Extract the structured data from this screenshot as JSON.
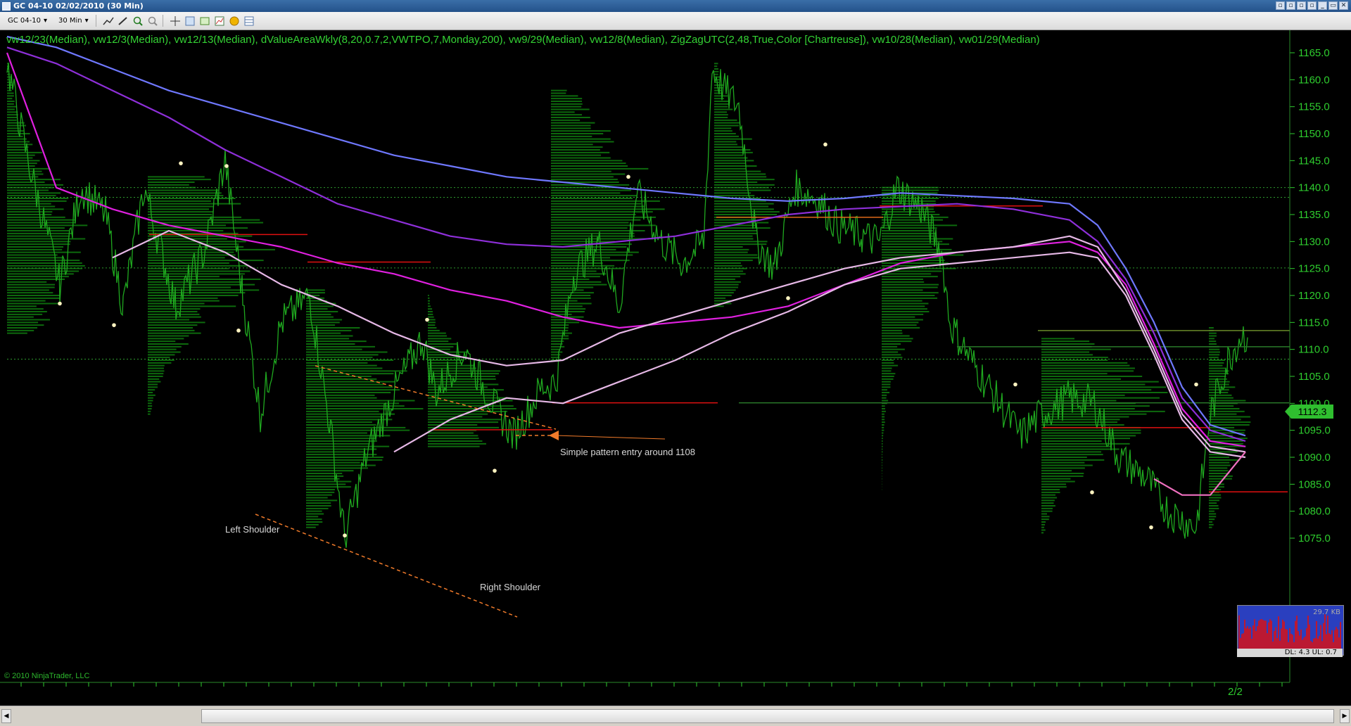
{
  "window": {
    "title": "GC 04-10  02/02/2010 (30 Min)",
    "buttons": [
      "▫",
      "▫",
      "▫",
      "▫",
      "_",
      "▭",
      "✕"
    ]
  },
  "toolbar": {
    "instrument": "GC 04-10",
    "interval": "30 Min",
    "icons": [
      "line-tool-icon",
      "pencil-icon",
      "zoom-in-icon",
      "zoom-out-icon",
      "crosshair-icon",
      "properties-icon",
      "data-series-icon",
      "strategy-icon",
      "money-icon",
      "table-icon"
    ]
  },
  "chart": {
    "indicator_label": "vw12/23(Median),  vw12/3(Median),  vw12/13(Median),  dValueAreaWkly(8,20,0.7,2,VWTPO,7,Monday,200),  vw9/29(Median),  vw12/8(Median),  ZigZagUTC(2,48,True,Color [Chartreuse]),  vw10/28(Median),  vw01/29(Median)",
    "copyright": "© 2010 NinjaTrader, LLC",
    "price_tag": "1112.3",
    "x_label": "2/2",
    "mini_text": "29.7 KB",
    "mini_status": "DL: 4.3 UL: 0.7",
    "annotations": {
      "entry": "Simple pattern entry around 1108",
      "left_shoulder": "Left Shoulder",
      "right_shoulder": "Right Shoulder"
    },
    "colors": {
      "price": "#1fa81f",
      "axis": "#2ecc2e",
      "profile": "#0d6a0d",
      "blue": "#6f78ff",
      "purple": "#8e2fd9",
      "magenta": "#e020e0",
      "light": "#e6b8e6",
      "pink": "#f070c0",
      "red": "#e01010",
      "orange": "#f07a2a"
    }
  },
  "chart_data": {
    "type": "line",
    "title": "",
    "y_ticks": [
      1165,
      1160,
      1155,
      1150,
      1145,
      1140,
      1135,
      1130,
      1125,
      1120,
      1115,
      1110,
      1105,
      1100,
      1095,
      1090,
      1085,
      1080,
      1075
    ],
    "ylim": [
      1073,
      1168
    ],
    "x_ticks": [
      "2/2"
    ],
    "last_price": 1112.3,
    "series": [
      {
        "name": "vw12/3(Median)",
        "values": [
          1168,
          1166,
          1162,
          1158,
          1155,
          1152,
          1149,
          1146,
          1144,
          1142,
          1141,
          1140,
          1139,
          1138,
          1137.5,
          1138,
          1139,
          1138.5,
          1138,
          1137,
          1133,
          1125,
          1115,
          1103,
          1096,
          1094
        ]
      },
      {
        "name": "vw12/13(Median)",
        "values": [
          1166,
          1163,
          1158,
          1153,
          1147,
          1142,
          1137,
          1134,
          1131,
          1129.5,
          1129,
          1130,
          1131,
          1133,
          1135,
          1136,
          1136.5,
          1137,
          1136,
          1134,
          1130,
          1123,
          1113,
          1101,
          1095,
          1093
        ]
      },
      {
        "name": "vw12/23(Median)",
        "values": [
          1165,
          1140,
          1136,
          1133,
          1131,
          1129,
          1126,
          1124,
          1121,
          1119,
          1116,
          1114,
          1115,
          1116,
          1118,
          1122,
          1126,
          1128,
          1129,
          1130,
          1128,
          1122,
          1111,
          1099,
          1093,
          1092
        ]
      },
      {
        "name": "vw12/8(Median)",
        "values": [
          null,
          null,
          1127,
          1132,
          1128,
          1122,
          1118,
          1113,
          1109,
          1107,
          1108,
          1113,
          1116,
          1119,
          1122,
          1125,
          1127,
          1128,
          1129,
          1131,
          1129,
          1121,
          1110,
          1098,
          1092,
          1091
        ]
      },
      {
        "name": "vw10/28(Median)",
        "values": [
          null,
          null,
          null,
          null,
          null,
          null,
          null,
          1091,
          1097,
          1101,
          1100,
          1104,
          1108,
          1113,
          1117,
          1122,
          1125,
          1126,
          1127,
          1128,
          1127,
          1120,
          1109,
          1097,
          1091,
          1090
        ]
      },
      {
        "name": "vw01/29(Median)",
        "values": [
          null,
          null,
          null,
          null,
          null,
          null,
          null,
          null,
          null,
          null,
          null,
          null,
          null,
          null,
          null,
          null,
          null,
          null,
          null,
          null,
          null,
          null,
          1086,
          1083,
          1083,
          1091
        ]
      }
    ],
    "price_levels": [
      1140,
      1138.2,
      1125.1,
      1108.2
    ],
    "poc_levels": [
      1131.3,
      1126.2,
      1095.1,
      1100.1,
      1134.5,
      1136.6,
      1095.5,
      1083.6
    ],
    "zigzag_points": [
      1118.5,
      1114.5,
      1144.5,
      1144,
      1113.5,
      1075.5,
      1115.5,
      1087.5,
      1142,
      1119.5,
      1148,
      1103.5,
      1083.5,
      1077,
      1103.5
    ]
  }
}
